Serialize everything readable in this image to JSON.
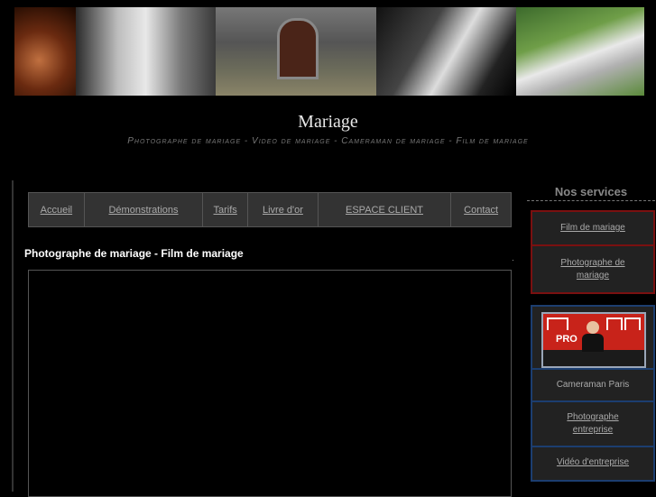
{
  "header": {
    "title": "Mariage",
    "subtitle": "Photographe de mariage - Video de mariage - Cameraman de mariage - Film de mariage"
  },
  "nav": {
    "items": [
      {
        "label": "Accueil"
      },
      {
        "label": "Démonstrations"
      },
      {
        "label": "Tarifs"
      },
      {
        "label": "Livre d'or"
      },
      {
        "label": "ESPACE CLIENT"
      },
      {
        "label": "Contact"
      }
    ]
  },
  "content": {
    "title": "Photographe de mariage - Film de mariage"
  },
  "sidebar": {
    "title": "Nos services",
    "services": [
      {
        "label": "Film de mariage"
      },
      {
        "label": "Photographe de mariage"
      }
    ],
    "pro": {
      "badge": "PRO",
      "items": [
        {
          "label": "Cameraman Paris"
        },
        {
          "label": "Photographe entreprise"
        },
        {
          "label": "Vidéo d'entreprise"
        }
      ]
    }
  },
  "colors": {
    "background": "#000000",
    "red_border": "#7a1010",
    "blue_border": "#1c3e70"
  }
}
